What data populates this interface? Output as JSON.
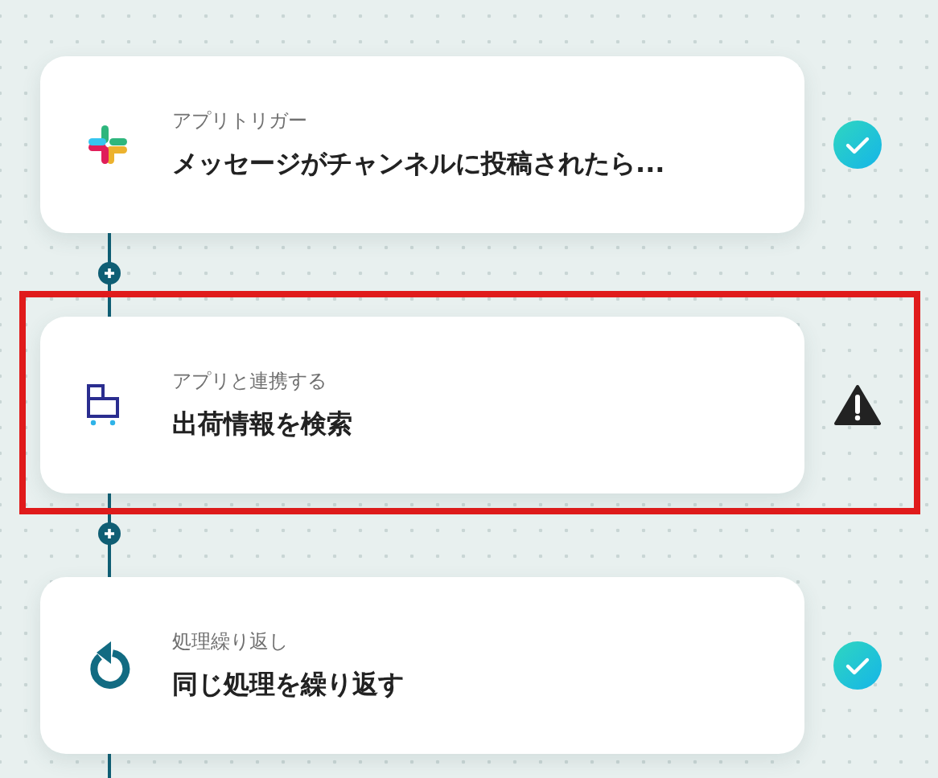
{
  "steps": [
    {
      "kind": "slack",
      "category": "アプリトリガー",
      "title": "メッセージがチャンネルに投稿されたら...",
      "completed": true,
      "warning": false,
      "highlighted": false
    },
    {
      "kind": "app",
      "category": "アプリと連携する",
      "title": "出荷情報を検索",
      "completed": false,
      "warning": true,
      "highlighted": true
    },
    {
      "kind": "loop",
      "category": "処理繰り返し",
      "title": "同じ処理を繰り返す",
      "completed": true,
      "warning": false,
      "highlighted": false
    }
  ]
}
